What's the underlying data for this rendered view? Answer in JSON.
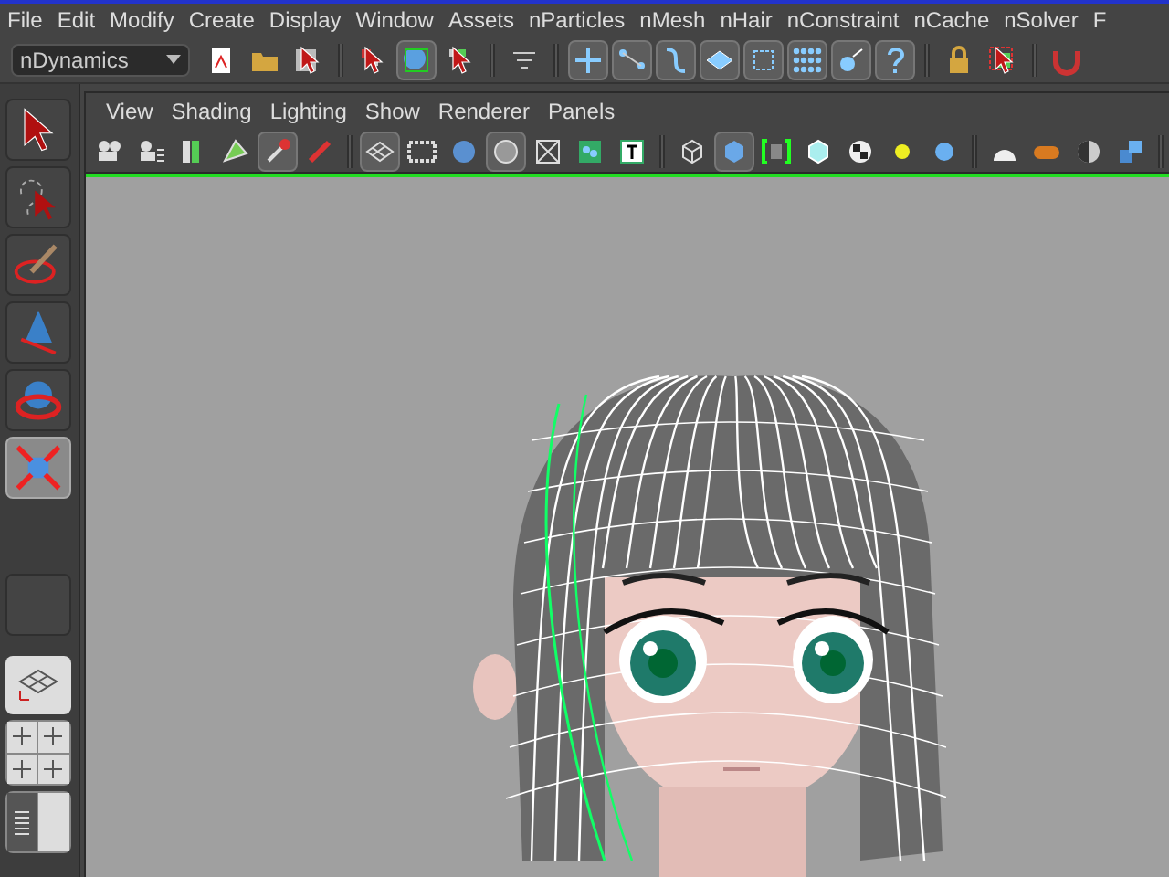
{
  "menu_bar": {
    "items": [
      "File",
      "Edit",
      "Modify",
      "Create",
      "Display",
      "Window",
      "Assets",
      "nParticles",
      "nMesh",
      "nHair",
      "nConstraint",
      "nCache",
      "nSolver",
      "F"
    ]
  },
  "status_line": {
    "menu_set": "nDynamics"
  },
  "toolbox": {
    "tools": [
      {
        "selected": false
      },
      {
        "selected": false
      },
      {
        "selected": false
      },
      {
        "selected": false
      },
      {
        "selected": false
      },
      {
        "selected": true
      }
    ]
  },
  "viewport": {
    "menu": [
      "View",
      "Shading",
      "Lighting",
      "Show",
      "Renderer",
      "Panels"
    ]
  }
}
